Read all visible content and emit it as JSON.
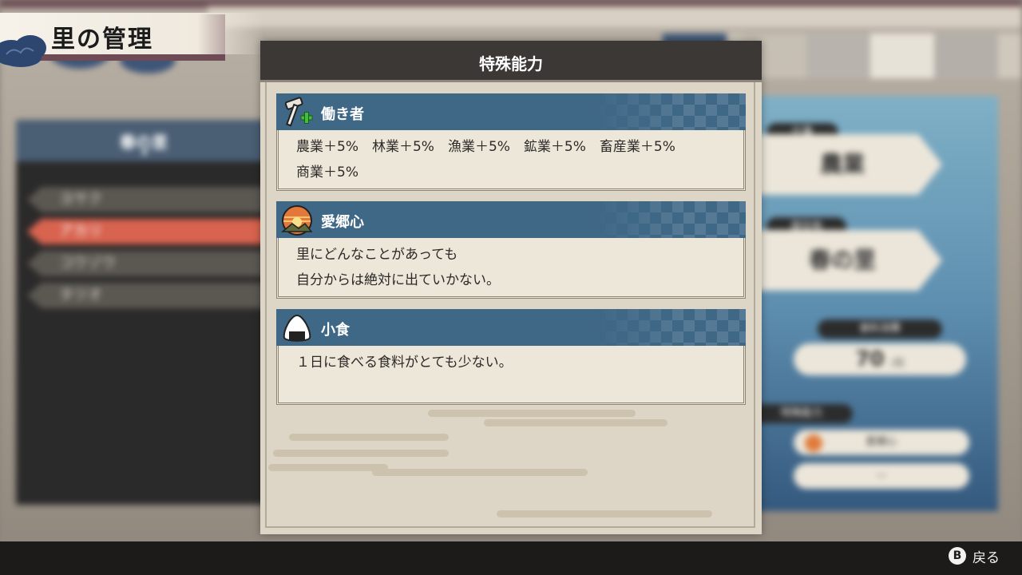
{
  "header": {
    "title": "里の管理"
  },
  "left_panel": {
    "village": "春の里",
    "characters": [
      {
        "name": "ヨサク",
        "active": false
      },
      {
        "name": "アカリ",
        "active": true
      },
      {
        "name": "コウゾウ",
        "active": false
      },
      {
        "name": "タツオ",
        "active": false
      }
    ]
  },
  "right_panel": {
    "job_label": "仕事",
    "job_value": "農業",
    "home_label": "居住地",
    "home_value": "春の里",
    "food_label": "食料消費",
    "food_value": "70",
    "food_unit": "/日",
    "ability_label": "特殊能力",
    "ability_slot1": "愛郷心",
    "ability_slot2": "—"
  },
  "modal": {
    "title": "特殊能力",
    "abilities": [
      {
        "name": "働き者",
        "icon": "hammer-plus-icon",
        "lines": [
          "農業＋5%　林業＋5%　漁業＋5%　鉱業＋5%　畜産業＋5%",
          "商業＋5%"
        ]
      },
      {
        "name": "愛郷心",
        "icon": "sunset-mountain-icon",
        "lines": [
          "里にどんなことがあっても",
          "自分からは絶対に出ていかない。"
        ]
      },
      {
        "name": "小食",
        "icon": "onigiri-icon",
        "lines": [
          "１日に食べる食料がとても少ない。"
        ]
      }
    ]
  },
  "footer": {
    "button": "B",
    "label": "戻る"
  },
  "colors": {
    "ability_header": "#3f6886",
    "modal_bg": "#ddd6c6",
    "active_row": "#d8634f"
  }
}
